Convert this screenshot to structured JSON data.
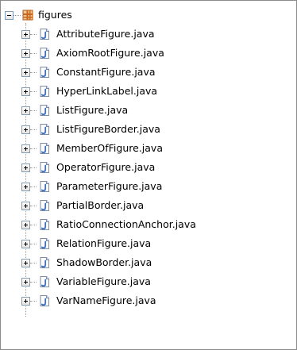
{
  "tree": {
    "package": {
      "label": "figures",
      "icon": "package-icon",
      "expanded": true
    },
    "files": [
      {
        "label": "AttributeFigure.java",
        "icon": "java-file-icon"
      },
      {
        "label": "AxiomRootFigure.java",
        "icon": "java-file-icon"
      },
      {
        "label": "ConstantFigure.java",
        "icon": "java-file-icon"
      },
      {
        "label": "HyperLinkLabel.java",
        "icon": "java-file-icon"
      },
      {
        "label": "ListFigure.java",
        "icon": "java-file-icon"
      },
      {
        "label": "ListFigureBorder.java",
        "icon": "java-file-icon"
      },
      {
        "label": "MemberOfFigure.java",
        "icon": "java-file-icon"
      },
      {
        "label": "OperatorFigure.java",
        "icon": "java-file-icon"
      },
      {
        "label": "ParameterFigure.java",
        "icon": "java-file-icon"
      },
      {
        "label": "PartialBorder.java",
        "icon": "java-file-icon"
      },
      {
        "label": "RatioConnectionAnchor.java",
        "icon": "java-file-icon"
      },
      {
        "label": "RelationFigure.java",
        "icon": "java-file-icon"
      },
      {
        "label": "ShadowBorder.java",
        "icon": "java-file-icon"
      },
      {
        "label": "VariableFigure.java",
        "icon": "java-file-icon"
      },
      {
        "label": "VarNameFigure.java",
        "icon": "java-file-icon"
      }
    ]
  },
  "colors": {
    "expander_border": "#7f9db9",
    "tree_line": "#9a9a9a",
    "package_icon": "#c8641e",
    "java_file_icon": "#3a6fc4"
  }
}
